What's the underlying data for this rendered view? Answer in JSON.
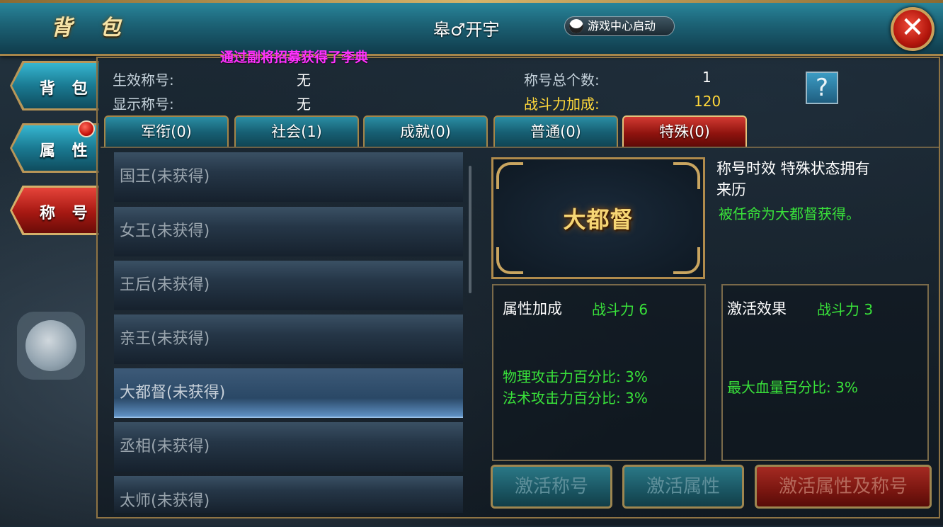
{
  "window": {
    "title": "背 包",
    "player_name": "皋♂开宇",
    "game_center_label": "游戏中心启动",
    "close_glyph": "✕"
  },
  "side_tabs": [
    {
      "label": "背 包",
      "active": false
    },
    {
      "label": "属 性",
      "active": false,
      "has_notification": true
    },
    {
      "label": "称 号",
      "active": true
    }
  ],
  "notice": "通过副将招募获得了李典",
  "info": {
    "effective_title_label": "生效称号:",
    "effective_title_value": "无",
    "display_title_label": "显示称号:",
    "display_title_value": "无",
    "total_titles_label": "称号总个数:",
    "total_titles_value": "1",
    "power_bonus_label": "战斗力加成:",
    "power_bonus_value": "120",
    "help_glyph": "?"
  },
  "category_tabs": [
    {
      "label": "军衔(0)",
      "active": false
    },
    {
      "label": "社会(1)",
      "active": false
    },
    {
      "label": "成就(0)",
      "active": false
    },
    {
      "label": "普通(0)",
      "active": false
    },
    {
      "label": "特殊(0)",
      "active": true
    }
  ],
  "titles": [
    {
      "label": "国王(未获得)",
      "selected": false
    },
    {
      "label": "女王(未获得)",
      "selected": false
    },
    {
      "label": "王后(未获得)",
      "selected": false
    },
    {
      "label": "亲王(未获得)",
      "selected": false
    },
    {
      "label": "大都督(未获得)",
      "selected": true
    },
    {
      "label": "丞相(未获得)",
      "selected": false
    },
    {
      "label": "太师(未获得)",
      "selected": false
    }
  ],
  "detail": {
    "badge_text": "大都督",
    "validity": "称号时效 特殊状态拥有",
    "origin_label": "来历",
    "origin_text": "被任命为大都督获得。",
    "attr_box": {
      "title": "属性加成",
      "power": "战斗力 6",
      "lines": [
        "物理攻击力百分比: 3%",
        "法术攻击力百分比: 3%"
      ]
    },
    "activate_box": {
      "title": "激活效果",
      "power": "战斗力 3",
      "lines": [
        "最大血量百分比: 3%"
      ]
    }
  },
  "buttons": {
    "activate_title": "激活称号",
    "activate_attr": "激活属性",
    "activate_both": "激活属性及称号"
  },
  "colors": {
    "accent_gold": "#ffd83a",
    "bonus_green": "#39e23a",
    "notice_magenta": "#ff33ff",
    "active_tab_red": "#8e130e",
    "tab_teal": "#176074"
  }
}
